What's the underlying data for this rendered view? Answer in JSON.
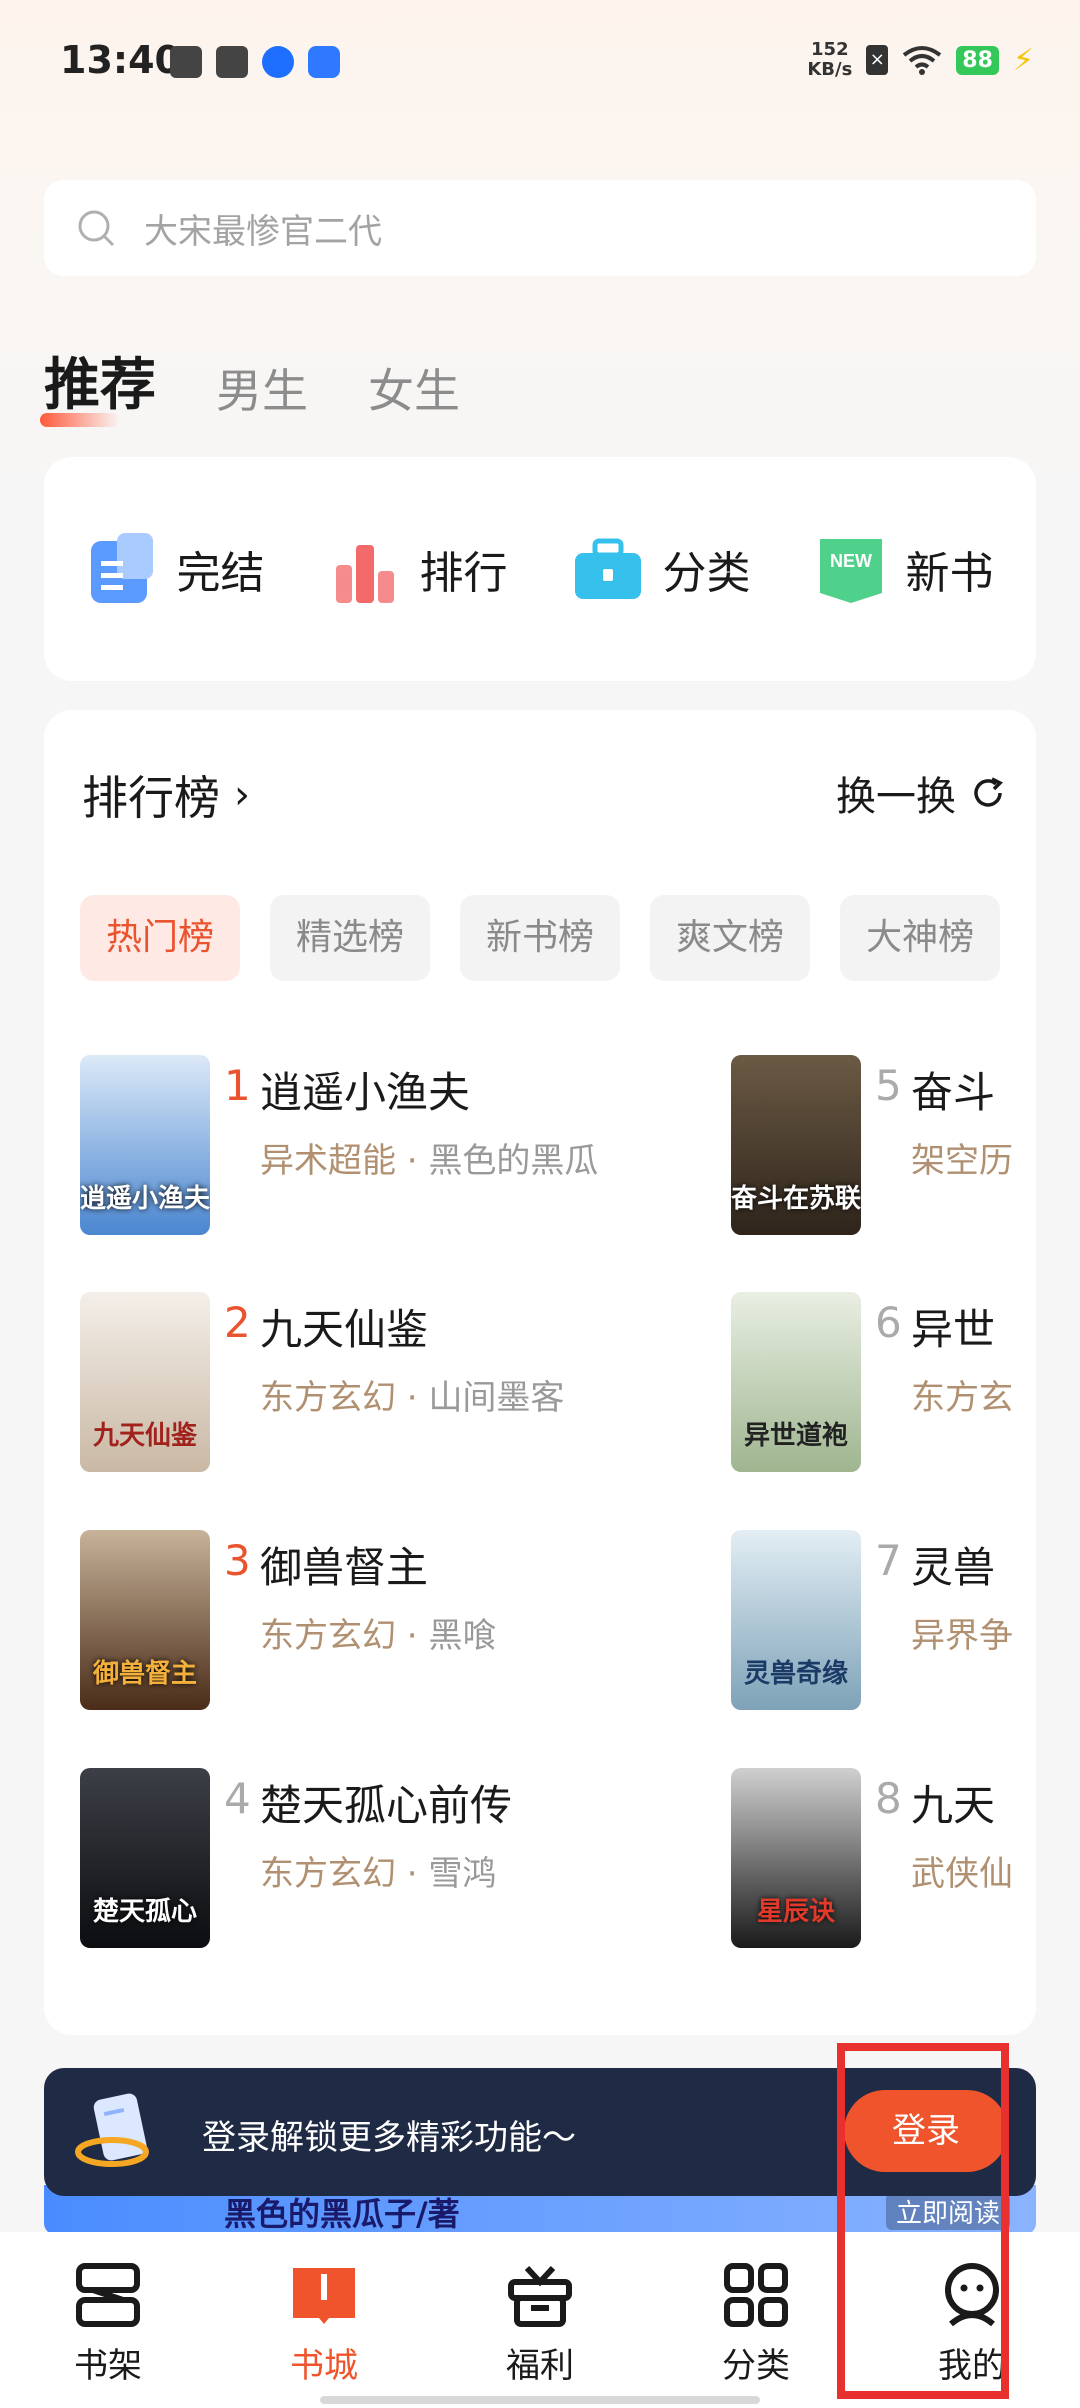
{
  "status_bar": {
    "time": "13:40",
    "net_speed_value": "152",
    "net_speed_unit": "KB/s",
    "battery": "88"
  },
  "search": {
    "placeholder": "大宋最惨官二代"
  },
  "tabs": [
    {
      "label": "推荐",
      "active": true
    },
    {
      "label": "男生",
      "active": false
    },
    {
      "label": "女生",
      "active": false
    }
  ],
  "quick_entries": [
    {
      "label": "完结",
      "icon": "book-complete-icon",
      "color": "#5b9bff"
    },
    {
      "label": "排行",
      "icon": "ranking-icon",
      "color": "#f46a6a"
    },
    {
      "label": "分类",
      "icon": "briefcase-icon",
      "color": "#36c1ec"
    },
    {
      "label": "新书",
      "icon": "new-badge-icon",
      "color": "#4fd18b",
      "badge": "NEW"
    }
  ],
  "ranking": {
    "title": "排行榜",
    "refresh_label": "换一换",
    "chips": [
      {
        "label": "热门榜",
        "active": true
      },
      {
        "label": "精选榜",
        "active": false
      },
      {
        "label": "新书榜",
        "active": false
      },
      {
        "label": "爽文榜",
        "active": false
      },
      {
        "label": "大神榜",
        "active": false
      }
    ],
    "books": [
      {
        "rank": "1",
        "title": "逍遥小渔夫",
        "genre": "异术超能",
        "author": "黑色的黑瓜",
        "cover_text": "逍遥小渔夫"
      },
      {
        "rank": "2",
        "title": "九天仙鉴",
        "genre": "东方玄幻",
        "author": "山间墨客",
        "cover_text": "九天仙鉴"
      },
      {
        "rank": "3",
        "title": "御兽督主",
        "genre": "东方玄幻",
        "author": "黑喰",
        "cover_text": "御兽督主"
      },
      {
        "rank": "4",
        "title": "楚天孤心前传",
        "genre": "东方玄幻",
        "author": "雪鸿",
        "cover_text": "楚天孤心"
      },
      {
        "rank": "5",
        "title": "奋斗",
        "genre": "架空历",
        "author": "",
        "cover_text": "奋斗在苏联"
      },
      {
        "rank": "6",
        "title": "异世",
        "genre": "东方玄",
        "author": "",
        "cover_text": "异世道袍"
      },
      {
        "rank": "7",
        "title": "灵兽",
        "genre": "异界争",
        "author": "",
        "cover_text": "灵兽奇缘"
      },
      {
        "rank": "8",
        "title": "九天",
        "genre": "武侠仙",
        "author": "",
        "cover_text": "星辰诀"
      }
    ]
  },
  "promo": {
    "text": "黑色的黑瓜子/著",
    "read_label": "立即阅读"
  },
  "login_bar": {
    "text": "登录解锁更多精彩功能～",
    "button": "登录"
  },
  "bottom_nav": [
    {
      "label": "书架",
      "icon": "bookshelf-icon",
      "active": false
    },
    {
      "label": "书城",
      "icon": "bookstore-icon",
      "active": true
    },
    {
      "label": "福利",
      "icon": "gift-icon",
      "active": false
    },
    {
      "label": "分类",
      "icon": "grid-icon",
      "active": false
    },
    {
      "label": "我的",
      "icon": "profile-icon",
      "active": false
    }
  ]
}
